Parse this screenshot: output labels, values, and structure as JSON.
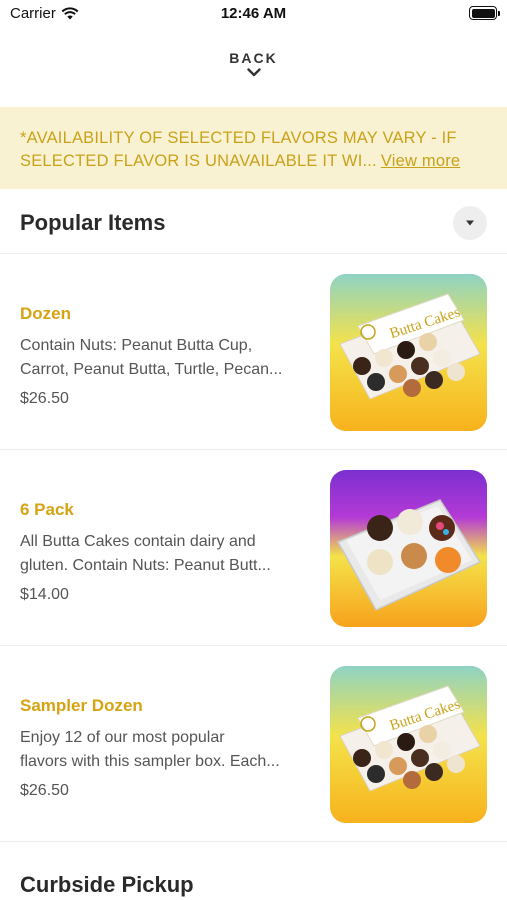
{
  "status_bar": {
    "carrier": "Carrier",
    "time": "12:46 AM"
  },
  "nav": {
    "back_label": "BACK"
  },
  "notice": {
    "text": "*AVAILABILITY OF SELECTED FLAVORS MAY VARY - IF SELECTED FLAVOR IS UNAVAILABLE IT WI...",
    "link_label": "View more"
  },
  "section": {
    "title": "Popular Items"
  },
  "items": [
    {
      "name": "Dozen",
      "desc_line1": "Contain Nuts: Peanut Butta Cup,",
      "desc_line2": "Carrot, Peanut Butta, Turtle, Pecan...",
      "price": "$26.50"
    },
    {
      "name": "6 Pack",
      "desc_line1": "All Butta Cakes contain dairy and",
      "desc_line2": "gluten. Contain Nuts: Peanut Butt...",
      "price": "$14.00"
    },
    {
      "name": "Sampler Dozen",
      "desc_line1": "Enjoy 12 of our most popular",
      "desc_line2": "flavors with this sampler box. Each...",
      "price": "$26.50"
    }
  ],
  "next_section": {
    "title": "Curbside Pickup"
  },
  "colors": {
    "accent": "#d6a313",
    "notice_bg": "#f8f2d2",
    "notice_text": "#c9a21a"
  }
}
